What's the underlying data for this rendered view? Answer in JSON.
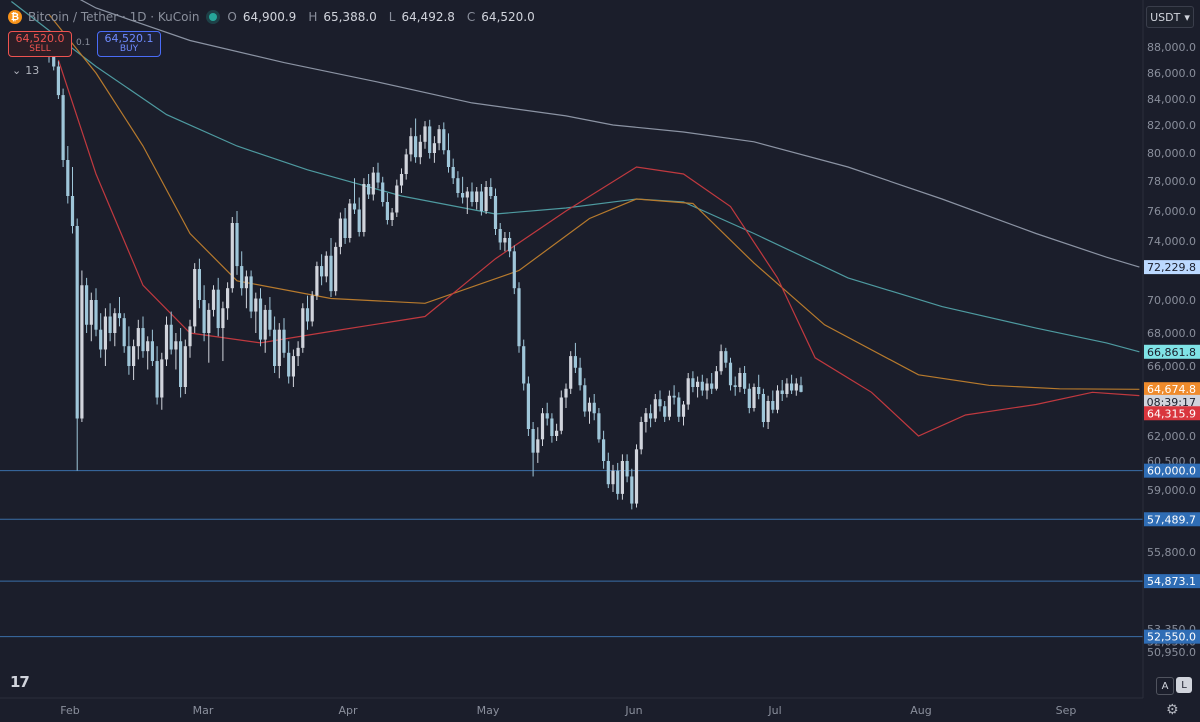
{
  "legend": {
    "coin_glyph": "₿",
    "symbol": "Bitcoin / Tether · 1D · KuCoin",
    "open_label": "O",
    "open": "64,900.9",
    "high_label": "H",
    "high": "65,388.0",
    "low_label": "L",
    "low": "64,492.8",
    "close_label": "C",
    "close": "64,520.0"
  },
  "trade": {
    "sell_price": "64,520.0",
    "sell_label": "SELL",
    "spread": "0.1",
    "buy_price": "64,520.1",
    "buy_label": "BUY"
  },
  "indicators": {
    "glyph": "⌄",
    "count": "13"
  },
  "toolbar": {
    "currency": "USDT",
    "currency_arrow": "▾",
    "logo": "17",
    "mode_auto": "A",
    "mode_log": "L",
    "settings_glyph": "⚙"
  },
  "colors": {
    "background": "#1b1e2b",
    "up": "#d1d4dc",
    "down": "#9fc6d9",
    "sma_red": "#c0393f",
    "sma_orange": "#b77a2d",
    "sma_teal": "#4e9aa0",
    "sma_gray": "#8b93a3",
    "hline": "#3a6fa8"
  },
  "chart_data": {
    "type": "candlestick",
    "title": "Bitcoin / Tether · 1D · KuCoin",
    "x_labels": [
      "Feb",
      "Mar",
      "Apr",
      "May",
      "Jun",
      "Jul",
      "Aug",
      "Sep"
    ],
    "y_ticks": [
      "88,000.0",
      "86,000.0",
      "84,000.0",
      "82,000.0",
      "80,000.0",
      "78,000.0",
      "76,000.0",
      "74,000.0",
      "70,000.0",
      "68,000.0",
      "66,000.0",
      "62,000.0",
      "60,500.0",
      "59,000.0",
      "55,800.0",
      "53,350.0",
      "52,050.0",
      "50,950.0"
    ],
    "y_tick_values": [
      88000,
      86000,
      84000,
      82000,
      80000,
      78000,
      76000,
      74000,
      70000,
      68000,
      66000,
      62000,
      60500,
      59000,
      55800,
      53350,
      52050,
      50950
    ],
    "price_badges": [
      {
        "label": "72,229.8",
        "value": 72229.8,
        "bg": "#bcd9ff",
        "fg": "#1b1e2b"
      },
      {
        "label": "66,861.8",
        "value": 66861.8,
        "bg": "#7fe3e6",
        "fg": "#1b1e2b"
      },
      {
        "label": "64,674.8",
        "value": 64674.8,
        "bg": "#ef8b2c",
        "fg": "#ffffff"
      },
      {
        "label": "08:39:17",
        "value": 63950,
        "bg": "#d1d4dc",
        "fg": "#1b1e2b"
      },
      {
        "label": "64,315.9",
        "value": 63300,
        "bg": "#d9363e",
        "fg": "#ffffff"
      }
    ],
    "horizontal_lines": [
      {
        "label": "60,000.0",
        "value": 60000
      },
      {
        "label": "57,489.7",
        "value": 57489.7
      },
      {
        "label": "54,873.1",
        "value": 54873.1
      },
      {
        "label": "52,550.0",
        "value": 52550
      }
    ],
    "candles": [
      [
        88000,
        88200,
        86800,
        87600
      ],
      [
        87600,
        87900,
        86200,
        86500
      ],
      [
        86500,
        86900,
        84000,
        84300
      ],
      [
        84300,
        84800,
        79000,
        79500
      ],
      [
        79500,
        80500,
        76500,
        77000
      ],
      [
        77000,
        79000,
        74500,
        75000
      ],
      [
        75000,
        75500,
        60000,
        63000
      ],
      [
        63000,
        72000,
        62800,
        71000
      ],
      [
        71000,
        71500,
        68000,
        68500
      ],
      [
        68500,
        70500,
        67500,
        70000
      ],
      [
        70000,
        70800,
        67800,
        68200
      ],
      [
        68200,
        69200,
        66500,
        67000
      ],
      [
        67000,
        69500,
        66000,
        69000
      ],
      [
        69000,
        69800,
        67500,
        68000
      ],
      [
        68000,
        69500,
        67200,
        69200
      ],
      [
        69200,
        70200,
        68400,
        68900
      ],
      [
        68900,
        69200,
        66800,
        67200
      ],
      [
        67200,
        68400,
        65500,
        66000
      ],
      [
        66000,
        67600,
        65200,
        67200
      ],
      [
        67200,
        68800,
        66400,
        68300
      ],
      [
        68300,
        69000,
        66500,
        66900
      ],
      [
        66900,
        67800,
        65800,
        67500
      ],
      [
        67500,
        68200,
        66000,
        66300
      ],
      [
        66300,
        67200,
        63800,
        64200
      ],
      [
        64200,
        66800,
        63500,
        66400
      ],
      [
        66400,
        69000,
        66000,
        68500
      ],
      [
        68500,
        69300,
        66700,
        67000
      ],
      [
        67000,
        68000,
        65800,
        67500
      ],
      [
        67500,
        68300,
        64200,
        64800
      ],
      [
        64800,
        67600,
        64400,
        67200
      ],
      [
        67200,
        68800,
        66500,
        68400
      ],
      [
        68400,
        72500,
        68000,
        72100
      ],
      [
        72100,
        72800,
        69500,
        70000
      ],
      [
        70000,
        71000,
        67500,
        68000
      ],
      [
        68000,
        69800,
        66200,
        69400
      ],
      [
        69400,
        71000,
        69000,
        70700
      ],
      [
        70700,
        71500,
        67800,
        68300
      ],
      [
        68300,
        69900,
        66300,
        69500
      ],
      [
        69500,
        71200,
        68800,
        70800
      ],
      [
        70800,
        75600,
        70500,
        75200
      ],
      [
        75200,
        76000,
        71700,
        72300
      ],
      [
        72300,
        73300,
        70300,
        70800
      ],
      [
        70800,
        72000,
        69500,
        71600
      ],
      [
        71600,
        72000,
        68900,
        69300
      ],
      [
        69300,
        70500,
        68000,
        70100
      ],
      [
        70100,
        70800,
        67200,
        67600
      ],
      [
        67600,
        69700,
        66800,
        69400
      ],
      [
        69400,
        70200,
        67800,
        68200
      ],
      [
        68200,
        69000,
        65600,
        66000
      ],
      [
        66000,
        68600,
        65300,
        68200
      ],
      [
        68200,
        68900,
        66500,
        66800
      ],
      [
        66800,
        67500,
        65000,
        65400
      ],
      [
        65400,
        67000,
        64800,
        66600
      ],
      [
        66600,
        67500,
        66000,
        67100
      ],
      [
        67100,
        69800,
        66800,
        69500
      ],
      [
        69500,
        70300,
        68200,
        68700
      ],
      [
        68700,
        70600,
        68400,
        70300
      ],
      [
        70300,
        72600,
        70000,
        72300
      ],
      [
        72300,
        73100,
        71000,
        71600
      ],
      [
        71600,
        73300,
        71200,
        73000
      ],
      [
        73000,
        74200,
        70200,
        70600
      ],
      [
        70600,
        73900,
        70300,
        73600
      ],
      [
        73600,
        75900,
        73100,
        75500
      ],
      [
        75500,
        76200,
        73800,
        74200
      ],
      [
        74200,
        76800,
        73900,
        76500
      ],
      [
        76500,
        78200,
        75800,
        76100
      ],
      [
        76100,
        76900,
        74300,
        74600
      ],
      [
        74600,
        78200,
        74300,
        77800
      ],
      [
        77800,
        78500,
        76800,
        77100
      ],
      [
        77100,
        79000,
        76700,
        78600
      ],
      [
        78600,
        79300,
        77500,
        77900
      ],
      [
        77900,
        78300,
        76300,
        76600
      ],
      [
        76600,
        77200,
        75100,
        75400
      ],
      [
        75400,
        76200,
        75000,
        75900
      ],
      [
        75900,
        78100,
        75600,
        77700
      ],
      [
        77700,
        78900,
        77200,
        78500
      ],
      [
        78500,
        80300,
        78100,
        79900
      ],
      [
        79900,
        81800,
        79400,
        81200
      ],
      [
        81200,
        82500,
        79300,
        79700
      ],
      [
        79700,
        81300,
        79200,
        80800
      ],
      [
        80800,
        82300,
        80300,
        81900
      ],
      [
        81900,
        82400,
        79600,
        80000
      ],
      [
        80000,
        81200,
        79300,
        80700
      ],
      [
        80700,
        82000,
        80200,
        81700
      ],
      [
        81700,
        82200,
        79900,
        80200
      ],
      [
        80200,
        81400,
        78600,
        79000
      ],
      [
        79000,
        79600,
        77800,
        78200
      ],
      [
        78200,
        78700,
        76900,
        77200
      ],
      [
        77200,
        78300,
        76500,
        76900
      ],
      [
        76900,
        77600,
        75800,
        77300
      ],
      [
        77300,
        77900,
        76300,
        76600
      ],
      [
        76600,
        77600,
        76100,
        77300
      ],
      [
        77300,
        77800,
        75700,
        76000
      ],
      [
        76000,
        78000,
        75800,
        77600
      ],
      [
        77600,
        78200,
        76800,
        77000
      ],
      [
        77000,
        77500,
        74400,
        74800
      ],
      [
        74800,
        75200,
        73400,
        73900
      ],
      [
        73900,
        74600,
        73300,
        74200
      ],
      [
        74200,
        74600,
        72900,
        73300
      ],
      [
        73300,
        73700,
        70400,
        70800
      ],
      [
        70800,
        71200,
        66800,
        67200
      ],
      [
        67200,
        67600,
        64600,
        65000
      ],
      [
        65000,
        65400,
        62000,
        62400
      ],
      [
        62400,
        62800,
        59700,
        61000
      ],
      [
        61000,
        62500,
        60400,
        61800
      ],
      [
        61800,
        63600,
        61400,
        63300
      ],
      [
        63300,
        63900,
        62600,
        63000
      ],
      [
        63000,
        63300,
        61600,
        62000
      ],
      [
        62000,
        62700,
        61700,
        62300
      ],
      [
        62300,
        64600,
        62100,
        64200
      ],
      [
        64200,
        65000,
        63600,
        64700
      ],
      [
        64700,
        66900,
        64400,
        66600
      ],
      [
        66600,
        67400,
        65600,
        65900
      ],
      [
        65900,
        66500,
        64600,
        64900
      ],
      [
        64900,
        65300,
        63100,
        63400
      ],
      [
        63400,
        64200,
        62700,
        63900
      ],
      [
        63900,
        64400,
        62900,
        63300
      ],
      [
        63300,
        63600,
        61600,
        61800
      ],
      [
        61800,
        62300,
        60100,
        60500
      ],
      [
        60500,
        61000,
        59100,
        59300
      ],
      [
        59300,
        60300,
        58900,
        60000
      ],
      [
        60000,
        60400,
        58500,
        58800
      ],
      [
        58800,
        60900,
        58500,
        60500
      ],
      [
        60500,
        60900,
        59400,
        59700
      ],
      [
        59700,
        60100,
        58000,
        58300
      ],
      [
        58300,
        61500,
        58100,
        61200
      ],
      [
        61200,
        63100,
        60900,
        62800
      ],
      [
        62800,
        63600,
        62200,
        63300
      ],
      [
        63300,
        63800,
        62500,
        63000
      ],
      [
        63000,
        64400,
        62800,
        64100
      ],
      [
        64100,
        64600,
        63400,
        63700
      ],
      [
        63700,
        64000,
        62800,
        63100
      ],
      [
        63100,
        64600,
        62900,
        64300
      ],
      [
        64300,
        64900,
        63800,
        64200
      ],
      [
        64200,
        64500,
        62800,
        63100
      ],
      [
        63100,
        64000,
        62600,
        63800
      ],
      [
        63800,
        65600,
        63500,
        65300
      ],
      [
        65300,
        65700,
        64500,
        64800
      ],
      [
        64800,
        65400,
        64200,
        65100
      ],
      [
        65100,
        65500,
        64300,
        64600
      ],
      [
        64600,
        65300,
        64100,
        65000
      ],
      [
        65000,
        65600,
        64400,
        64700
      ],
      [
        64700,
        66000,
        64600,
        65700
      ],
      [
        65700,
        67300,
        65500,
        66900
      ],
      [
        66900,
        67100,
        65900,
        66200
      ],
      [
        66200,
        66500,
        64600,
        64900
      ],
      [
        64900,
        65400,
        64300,
        64800
      ],
      [
        64800,
        65900,
        64500,
        65600
      ],
      [
        65600,
        66000,
        64400,
        64700
      ],
      [
        64700,
        65000,
        63300,
        63600
      ],
      [
        63600,
        65000,
        63400,
        64800
      ],
      [
        64800,
        65500,
        64100,
        64400
      ],
      [
        64400,
        64700,
        62500,
        62800
      ],
      [
        62800,
        64300,
        62400,
        64000
      ],
      [
        64000,
        64600,
        63300,
        63500
      ],
      [
        63500,
        64900,
        63300,
        64600
      ],
      [
        64600,
        65200,
        64000,
        64400
      ],
      [
        64400,
        65300,
        64200,
        65000
      ],
      [
        65000,
        65500,
        64400,
        64600
      ],
      [
        64600,
        65300,
        64300,
        65000
      ],
      [
        64900.9,
        65388,
        64492.8,
        64520
      ]
    ],
    "moving_averages": [
      {
        "color_key": "sma_gray",
        "points": [
          [
            -8,
            94500
          ],
          [
            10,
            91000
          ],
          [
            30,
            88500
          ],
          [
            50,
            86800
          ],
          [
            70,
            85300
          ],
          [
            90,
            83700
          ],
          [
            110,
            82700
          ],
          [
            120,
            82000
          ],
          [
            135,
            81500
          ],
          [
            150,
            80800
          ],
          [
            170,
            79000
          ],
          [
            190,
            76800
          ],
          [
            210,
            74500
          ],
          [
            225,
            72900
          ],
          [
            232,
            72230
          ]
        ]
      },
      {
        "color_key": "sma_teal",
        "points": [
          [
            -8,
            91500
          ],
          [
            10,
            86500
          ],
          [
            25,
            82800
          ],
          [
            40,
            80500
          ],
          [
            55,
            78800
          ],
          [
            75,
            77000
          ],
          [
            95,
            75800
          ],
          [
            110,
            76200
          ],
          [
            125,
            76800
          ],
          [
            135,
            76600
          ],
          [
            150,
            74500
          ],
          [
            170,
            71500
          ],
          [
            190,
            69600
          ],
          [
            210,
            68300
          ],
          [
            225,
            67400
          ],
          [
            232,
            66860
          ]
        ]
      },
      {
        "color_key": "sma_orange",
        "points": [
          [
            0,
            90500
          ],
          [
            10,
            86000
          ],
          [
            20,
            80500
          ],
          [
            30,
            74500
          ],
          [
            40,
            71300
          ],
          [
            60,
            70100
          ],
          [
            80,
            69800
          ],
          [
            100,
            72000
          ],
          [
            115,
            75500
          ],
          [
            125,
            76800
          ],
          [
            137,
            76500
          ],
          [
            150,
            72500
          ],
          [
            165,
            68500
          ],
          [
            185,
            65500
          ],
          [
            200,
            64900
          ],
          [
            215,
            64700
          ],
          [
            232,
            64670
          ]
        ]
      },
      {
        "color_key": "sma_red",
        "points": [
          [
            2,
            87000
          ],
          [
            10,
            78500
          ],
          [
            20,
            71000
          ],
          [
            30,
            68000
          ],
          [
            45,
            67400
          ],
          [
            60,
            68100
          ],
          [
            80,
            69000
          ],
          [
            95,
            72800
          ],
          [
            110,
            76000
          ],
          [
            125,
            79000
          ],
          [
            135,
            78500
          ],
          [
            145,
            76300
          ],
          [
            155,
            71500
          ],
          [
            163,
            66500
          ],
          [
            175,
            64500
          ],
          [
            185,
            62000
          ],
          [
            195,
            63200
          ],
          [
            210,
            63800
          ],
          [
            222,
            64500
          ],
          [
            232,
            64310
          ]
        ]
      }
    ]
  }
}
